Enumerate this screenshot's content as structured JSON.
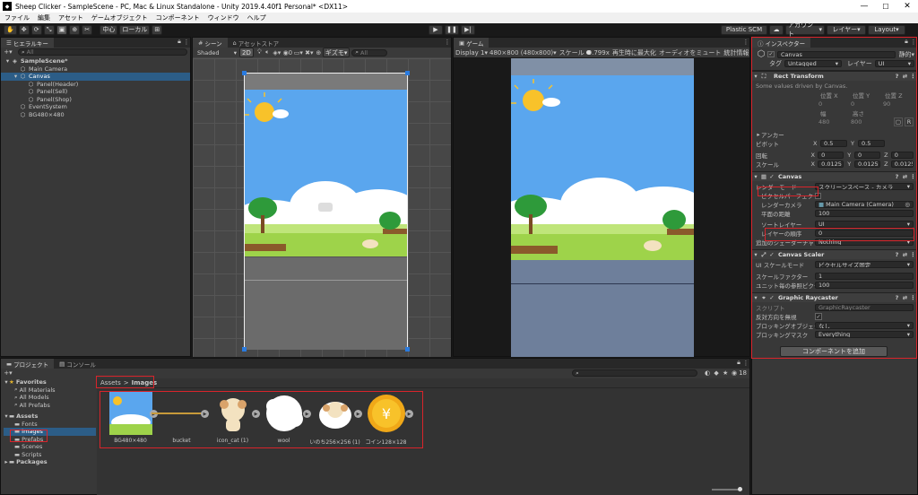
{
  "window": {
    "title": "Sheep Clicker - SampleScene - PC, Mac & Linux Standalone - Unity 2019.4.40f1 Personal* <DX11>"
  },
  "menu": [
    "ファイル",
    "編集",
    "アセット",
    "ゲームオブジェクト",
    "コンポーネント",
    "ウィンドウ",
    "ヘルプ"
  ],
  "toolbar": {
    "pivot": "中心",
    "space": "ローカル",
    "plastic": "Plastic SCM",
    "account": "アカウント",
    "layers": "レイヤー",
    "layout": "Layout"
  },
  "hierarchy": {
    "tab": "ヒエラルキー",
    "search_all": "All",
    "items": [
      {
        "label": "SampleScene*",
        "indent": 0
      },
      {
        "label": "Main Camera",
        "indent": 1
      },
      {
        "label": "Canvas",
        "indent": 1
      },
      {
        "label": "Panel(Header)",
        "indent": 2
      },
      {
        "label": "Panel(Sell)",
        "indent": 2
      },
      {
        "label": "Panel(Shop)",
        "indent": 2
      },
      {
        "label": "EventSystem",
        "indent": 1
      },
      {
        "label": "BG480×480",
        "indent": 1
      }
    ]
  },
  "scene": {
    "tab_scene": "シーン",
    "tab_asset_store": "アセットストア",
    "shading": "Shaded",
    "mode_2d": "2D",
    "gizmos": "ギズモ",
    "search_all": "All",
    "persp_label": "照"
  },
  "game": {
    "tab": "ゲーム",
    "display": "Display 1",
    "resolution": "480×800 (480x800)",
    "scale_label": "スケール",
    "scale_value": "0.799x",
    "maximize": "再生時に最大化",
    "mute": "オーディオをミュート",
    "stats": "統計情報"
  },
  "inspector": {
    "tab": "インスペクター",
    "object_name": "Canvas",
    "static": "静的",
    "tag_label": "タグ",
    "tag_value": "Untagged",
    "layer_label": "レイヤー",
    "layer_value": "UI",
    "rect": {
      "title": "Rect Transform",
      "note": "Some values driven by Canvas.",
      "pos_x_label": "位置 X",
      "pos_y_label": "位置 Y",
      "pos_z_label": "位置 Z",
      "pos_x": "0",
      "pos_y": "0",
      "pos_z": "90",
      "width_label": "幅",
      "height_label": "高さ",
      "width": "480",
      "height": "800",
      "anchor": "アンカー",
      "pivot_label": "ピボット",
      "pivot_x": "0.5",
      "pivot_y": "0.5",
      "rotation_label": "回転",
      "rot_x": "0",
      "rot_y": "0",
      "rot_z": "0",
      "scale_label": "スケール",
      "scale_x": "0.0125",
      "scale_y": "0.0125",
      "scale_z": "0.0125"
    },
    "canvas": {
      "title": "Canvas",
      "render_mode_label": "レンダーモード",
      "render_mode": "スクリーンスペース - カメラ",
      "pixel_perfect_label": "ピクセルパーフェクト",
      "render_camera_label": "レンダーカメラ",
      "render_camera": "Main Camera (Camera)",
      "plane_distance_label": "平面の距離",
      "plane_distance": "100",
      "sorting_layer_label": "ソートレイヤー",
      "sorting_layer": "UI",
      "order_label": "レイヤーの順序",
      "order": "0",
      "shader_label": "追加のシェーダーチャンネル",
      "shader": "Nothing"
    },
    "scaler": {
      "title": "Canvas Scaler",
      "mode_label": "UI スケールモード",
      "mode": "ピクセルサイズ固定",
      "factor_label": "スケールファクター",
      "factor": "1",
      "ppu_label": "ユニット毎の参照ピクセル",
      "ppu": "100"
    },
    "raycaster": {
      "title": "Graphic Raycaster",
      "script_label": "スクリプト",
      "script": "GraphicRaycaster",
      "reversed_label": "反対方向を無視",
      "blocking_obj_label": "ブロッキングオブジェクト",
      "blocking_obj": "なし",
      "blocking_mask_label": "ブロッキングマスク",
      "blocking_mask": "Everything"
    },
    "add_component": "コンポーネントを追加"
  },
  "project": {
    "tab_project": "プロジェクト",
    "tab_console": "コンソール",
    "favorites": "Favorites",
    "fav_items": [
      "All Materials",
      "All Models",
      "All Prefabs"
    ],
    "assets": "Assets",
    "asset_folders": [
      "Fonts",
      "Images",
      "Prefabs",
      "Scenes",
      "Scripts"
    ],
    "packages": "Packages",
    "breadcrumb_root": "Assets",
    "breadcrumb_current": "Images",
    "count": "18",
    "thumbs": [
      "BG480×480",
      "bucket",
      "icon_cat (1)",
      "wool",
      "いのち256×256 (1)",
      "コイン128×128"
    ]
  }
}
